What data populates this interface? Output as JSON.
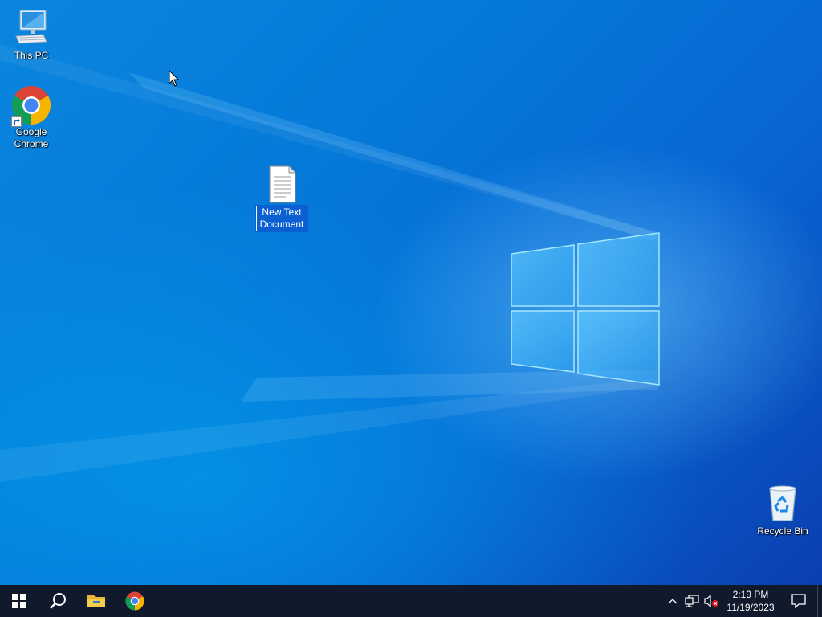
{
  "desktop": {
    "icons": [
      {
        "name": "this-pc",
        "label": "This PC",
        "icon": "computer-icon"
      },
      {
        "name": "google-chrome",
        "label": "Google\nChrome",
        "icon": "chrome-icon"
      },
      {
        "name": "new-text-document",
        "label": "New Text\nDocument",
        "icon": "text-file-icon",
        "selected": true
      },
      {
        "name": "recycle-bin",
        "label": "Recycle Bin",
        "icon": "recycle-bin-icon"
      }
    ],
    "wallpaper": {
      "accent": "#0078d7",
      "logo_color": "#7fd4ff"
    }
  },
  "taskbar": {
    "background": "#101a2c",
    "buttons": [
      {
        "name": "start",
        "icon": "windows-logo-icon"
      },
      {
        "name": "search",
        "icon": "search-icon"
      },
      {
        "name": "file-explorer",
        "icon": "folder-icon"
      },
      {
        "name": "chrome",
        "icon": "chrome-icon"
      }
    ],
    "tray": {
      "icons": [
        "chevron-up-icon",
        "network-icon",
        "volume-muted-icon"
      ],
      "time": "2:19 PM",
      "date": "11/19/2023",
      "notification_icon": "action-center-icon"
    }
  }
}
